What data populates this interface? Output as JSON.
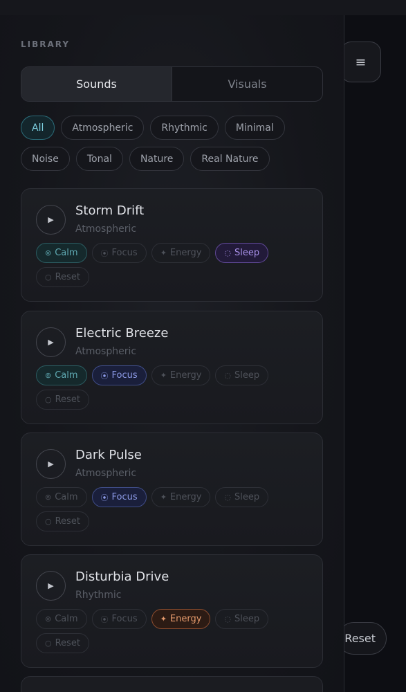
{
  "library": {
    "title": "LIBRARY",
    "tabs": [
      {
        "label": "Sounds",
        "active": true
      },
      {
        "label": "Visuals",
        "active": false
      }
    ],
    "filters": [
      {
        "label": "All",
        "active": true
      },
      {
        "label": "Atmospheric",
        "active": false
      },
      {
        "label": "Rhythmic",
        "active": false
      },
      {
        "label": "Minimal",
        "active": false
      },
      {
        "label": "Noise",
        "active": false
      },
      {
        "label": "Tonal",
        "active": false
      },
      {
        "label": "Nature",
        "active": false
      },
      {
        "label": "Real Nature",
        "active": false
      }
    ],
    "tag_icons": {
      "calm": "⊚",
      "focus": "⦿",
      "energy": "✦",
      "sleep": "◌",
      "reset": "○"
    },
    "tracks": [
      {
        "title": "Storm Drift",
        "genre": "Atmospheric",
        "tags": {
          "calm": "Calm",
          "focus": "Focus",
          "energy": "Energy",
          "sleep": "Sleep",
          "reset": "Reset"
        },
        "active_tags": [
          "calm",
          "sleep"
        ]
      },
      {
        "title": "Electric Breeze",
        "genre": "Atmospheric",
        "tags": {
          "calm": "Calm",
          "focus": "Focus",
          "energy": "Energy",
          "sleep": "Sleep",
          "reset": "Reset"
        },
        "active_tags": [
          "calm",
          "focus"
        ]
      },
      {
        "title": "Dark Pulse",
        "genre": "Atmospheric",
        "tags": {
          "calm": "Calm",
          "focus": "Focus",
          "energy": "Energy",
          "sleep": "Sleep",
          "reset": "Reset"
        },
        "active_tags": [
          "focus"
        ]
      },
      {
        "title": "Disturbia Drive",
        "genre": "Rhythmic",
        "tags": {
          "calm": "Calm",
          "focus": "Focus",
          "energy": "Energy",
          "sleep": "Sleep",
          "reset": "Reset"
        },
        "active_tags": [
          "energy"
        ]
      }
    ]
  },
  "controls": {
    "menu_icon": "≡",
    "reset_label": "Reset"
  },
  "colors": {
    "accent_calm": "#5fa9b2",
    "accent_focus": "#8c9ae6",
    "accent_energy": "#e59a6c",
    "accent_sleep": "#a890e8"
  }
}
